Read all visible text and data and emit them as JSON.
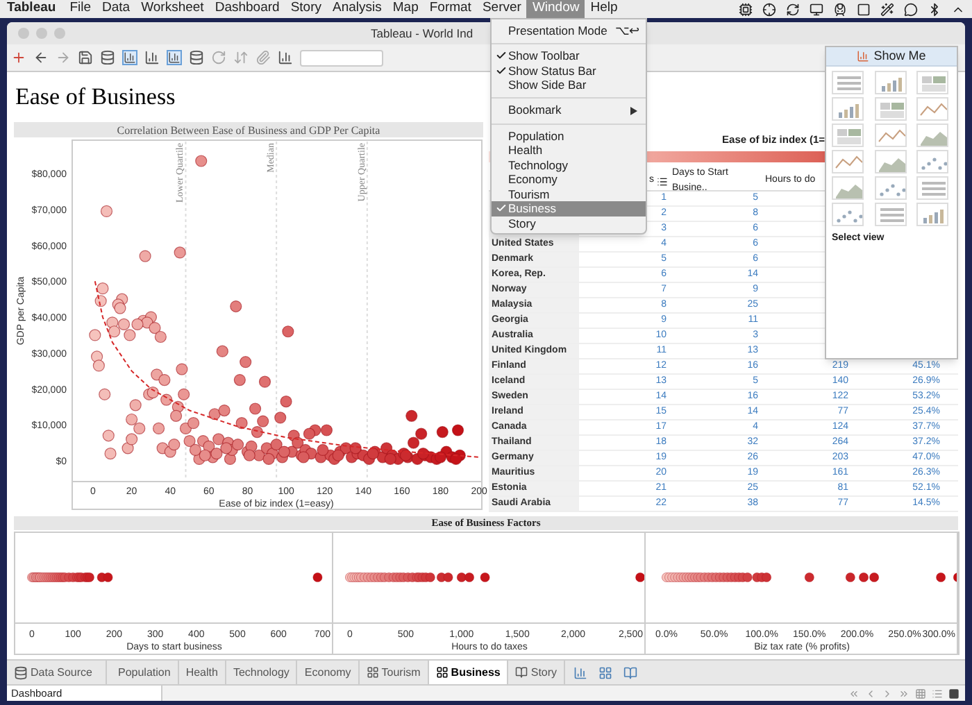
{
  "menubar": {
    "app": "Tableau",
    "items": [
      {
        "label": "File",
        "selected": false
      },
      {
        "label": "Data",
        "selected": false
      },
      {
        "label": "Worksheet",
        "selected": false
      },
      {
        "label": "Dashboard",
        "selected": false
      },
      {
        "label": "Story",
        "selected": false
      },
      {
        "label": "Analysis",
        "selected": false
      },
      {
        "label": "Map",
        "selected": false
      },
      {
        "label": "Format",
        "selected": false
      },
      {
        "label": "Server",
        "selected": false
      },
      {
        "label": "Window",
        "selected": true
      },
      {
        "label": "Help",
        "selected": false
      }
    ]
  },
  "window": {
    "title": "Tableau - World Ind"
  },
  "window_menu": {
    "items": [
      {
        "kind": "item",
        "label": "Presentation Mode",
        "shortcut": "⌥↩"
      },
      {
        "kind": "separator"
      },
      {
        "kind": "check",
        "label": "Show Toolbar",
        "checked": true
      },
      {
        "kind": "check",
        "label": "Show Status Bar",
        "checked": true
      },
      {
        "kind": "check",
        "label": "Show Side Bar",
        "checked": false
      },
      {
        "kind": "separator"
      },
      {
        "kind": "submenu",
        "label": "Bookmark"
      },
      {
        "kind": "separator"
      },
      {
        "kind": "sheet",
        "label": "Population",
        "checked": false,
        "selected": false
      },
      {
        "kind": "sheet",
        "label": "Health",
        "checked": false,
        "selected": false
      },
      {
        "kind": "sheet",
        "label": "Technology",
        "checked": false,
        "selected": false
      },
      {
        "kind": "sheet",
        "label": "Economy",
        "checked": false,
        "selected": false
      },
      {
        "kind": "sheet",
        "label": "Tourism",
        "checked": false,
        "selected": false
      },
      {
        "kind": "sheet",
        "label": "Business",
        "checked": true,
        "selected": true
      },
      {
        "kind": "sheet",
        "label": "Story",
        "checked": false,
        "selected": false
      }
    ]
  },
  "dashboard": {
    "title": "Ease of Business",
    "scatter": {
      "chart_data": {
        "type": "scatter",
        "title": "Correlation Between Ease of Business and GDP Per Capita",
        "xlabel": "Ease of biz index (1=easy)",
        "ylabel": "GDP per Capita",
        "xlim": [
          -10.8,
          201.4
        ],
        "ylim": [
          -5800,
          89300
        ],
        "xticks": [
          0,
          20,
          40,
          60,
          80,
          100,
          120,
          140,
          160,
          180,
          200
        ],
        "yticks": [
          {
            "value": 0,
            "label": "$0"
          },
          {
            "value": 10000,
            "label": "$10,000"
          },
          {
            "value": 20000,
            "label": "$20,000"
          },
          {
            "value": 30000,
            "label": "$30,000"
          },
          {
            "value": 40000,
            "label": "$40,000"
          },
          {
            "value": 50000,
            "label": "$50,000"
          },
          {
            "value": 60000,
            "label": "$60,000"
          },
          {
            "value": 70000,
            "label": "$70,000"
          },
          {
            "value": 80000,
            "label": "$80,000"
          }
        ],
        "x": [
          56,
          7,
          27,
          45,
          5,
          4,
          15,
          13,
          14,
          10,
          16,
          26,
          30,
          28,
          11,
          19,
          23,
          32,
          35,
          1,
          2,
          3,
          6,
          8,
          9,
          74,
          101,
          67,
          79,
          76,
          89,
          100,
          46,
          33,
          37,
          47,
          29,
          31,
          38,
          22,
          20,
          24,
          34,
          44,
          43,
          18,
          20,
          36,
          40,
          42,
          48,
          52,
          63,
          68,
          77,
          84,
          88,
          85,
          97,
          55,
          71,
          62,
          165,
          170,
          181,
          189,
          166,
          115,
          121,
          112,
          104,
          50,
          57,
          65,
          60,
          70,
          72,
          75,
          80,
          82,
          86,
          90,
          93,
          95,
          98,
          103,
          106,
          108,
          110,
          113,
          118,
          123,
          125,
          128,
          131,
          134,
          137,
          140,
          143,
          146,
          150,
          152,
          155,
          158,
          161,
          163,
          168,
          172,
          175,
          178,
          183,
          186,
          190,
          53,
          58,
          64,
          69,
          81,
          91,
          99,
          109,
          119,
          127,
          136,
          145,
          154,
          162,
          171,
          180,
          188
        ],
        "values": [
          83500,
          69500,
          57000,
          58000,
          48000,
          44500,
          45000,
          43500,
          42500,
          38500,
          38000,
          39000,
          40000,
          38500,
          36000,
          35000,
          38000,
          37000,
          34500,
          35000,
          29000,
          26500,
          18500,
          7000,
          2000,
          43000,
          36000,
          30500,
          27500,
          22500,
          22000,
          16500,
          25500,
          24000,
          22500,
          18500,
          18500,
          19000,
          17000,
          15500,
          11500,
          9000,
          9000,
          15000,
          12500,
          3500,
          6000,
          3500,
          2500,
          4500,
          9000,
          10500,
          13000,
          14000,
          10500,
          14500,
          11000,
          8000,
          12000,
          500,
          500,
          1000,
          12500,
          7500,
          8000,
          8500,
          5000,
          8500,
          8500,
          7500,
          7000,
          5500,
          5500,
          6000,
          4000,
          5000,
          3000,
          4500,
          2500,
          4000,
          1500,
          3500,
          2000,
          4500,
          1000,
          2500,
          5000,
          1500,
          3000,
          2000,
          1000,
          1500,
          500,
          2500,
          3500,
          1000,
          2000,
          1500,
          500,
          2500,
          1000,
          3500,
          1500,
          500,
          2000,
          1000,
          500,
          1500,
          1000,
          500,
          2500,
          1000,
          1500,
          3000,
          1500,
          2000,
          3500,
          1500,
          500,
          2500,
          1000,
          3000,
          1500,
          3500,
          2000,
          500,
          1500,
          2000,
          1000,
          500
        ],
        "ref_lines": [
          {
            "axis": "x",
            "value": 48,
            "label": "Lower Quartile"
          },
          {
            "axis": "x",
            "value": 95,
            "label": "Median"
          },
          {
            "axis": "x",
            "value": 142,
            "label": "Upper Quartile"
          }
        ]
      }
    },
    "legend": {
      "title": "Ease of biz index (1="
    },
    "table": {
      "columns": [
        {
          "label": "s",
          "sorted": true
        },
        {
          "label": "Days to Start Busine.."
        },
        {
          "label": "Hours to do"
        }
      ],
      "rows": [
        {
          "rank": "1",
          "days": "5"
        },
        {
          "rank": "2",
          "days": "8"
        },
        {
          "rank": "3",
          "days": "6"
        },
        {
          "country": "United States",
          "rank": "4",
          "days": "6"
        },
        {
          "country": "Denmark",
          "rank": "5",
          "days": "6"
        },
        {
          "country": "Korea, Rep.",
          "rank": "6",
          "days": "14"
        },
        {
          "country": "Norway",
          "rank": "7",
          "days": "9"
        },
        {
          "country": "Malaysia",
          "rank": "8",
          "days": "25"
        },
        {
          "country": "Georgia",
          "rank": "9",
          "days": "11"
        },
        {
          "country": "Australia",
          "rank": "10",
          "days": "3"
        },
        {
          "country": "United Kingdom",
          "rank": "11",
          "days": "13"
        },
        {
          "country": "Finland",
          "rank": "12",
          "days": "16",
          "hours": "219",
          "tax": "45.1%"
        },
        {
          "country": "Iceland",
          "rank": "13",
          "days": "5",
          "hours": "140",
          "tax": "26.9%"
        },
        {
          "country": "Sweden",
          "rank": "14",
          "days": "16",
          "hours": "122",
          "tax": "53.2%"
        },
        {
          "country": "Ireland",
          "rank": "15",
          "days": "14",
          "hours": "77",
          "tax": "25.4%"
        },
        {
          "country": "Canada",
          "rank": "17",
          "days": "4",
          "hours": "124",
          "tax": "37.7%"
        },
        {
          "country": "Thailand",
          "rank": "18",
          "days": "32",
          "hours": "264",
          "tax": "37.2%"
        },
        {
          "country": "Germany",
          "rank": "19",
          "days": "26",
          "hours": "203",
          "tax": "47.0%"
        },
        {
          "country": "Mauritius",
          "rank": "20",
          "days": "19",
          "hours": "161",
          "tax": "26.3%"
        },
        {
          "country": "Estonia",
          "rank": "21",
          "days": "25",
          "hours": "81",
          "tax": "52.1%"
        },
        {
          "country": "Saudi Arabia",
          "rank": "22",
          "days": "38",
          "hours": "77",
          "tax": "14.5%"
        }
      ]
    },
    "factors": {
      "title": "Ease of Business Factors",
      "charts": [
        {
          "kind": "days",
          "xlabel": "Days to start business",
          "ticks": [
            "0",
            "100",
            "200",
            "300",
            "400",
            "500",
            "600",
            "700"
          ]
        },
        {
          "kind": "hours",
          "xlabel": "Hours to do taxes",
          "ticks": [
            "0",
            "500",
            "1,000",
            "1,500",
            "2,000",
            "2,500"
          ]
        },
        {
          "kind": "tax",
          "xlabel": "Biz tax rate (% profits)",
          "ticks": [
            "0.0%",
            "50.0%",
            "100.0%",
            "150.0%",
            "200.0%",
            "250.0%",
            "300.0%"
          ]
        }
      ]
    }
  },
  "show_me": {
    "title": "Show Me",
    "footer": "Select view"
  },
  "sheet_tabs": [
    {
      "kind": "datasource",
      "label": "Data Source",
      "selected": false
    },
    {
      "kind": "sheet",
      "label": "Population",
      "selected": false
    },
    {
      "kind": "sheet",
      "label": "Health",
      "selected": false
    },
    {
      "kind": "sheet",
      "label": "Technology",
      "selected": false
    },
    {
      "kind": "sheet",
      "label": "Economy",
      "selected": false
    },
    {
      "kind": "dashboard",
      "label": "Tourism",
      "selected": false
    },
    {
      "kind": "dashboard",
      "label": "Business",
      "selected": true
    },
    {
      "kind": "story",
      "label": "Story",
      "selected": false
    }
  ],
  "status_bar": {
    "sheet": "Dashboard"
  }
}
